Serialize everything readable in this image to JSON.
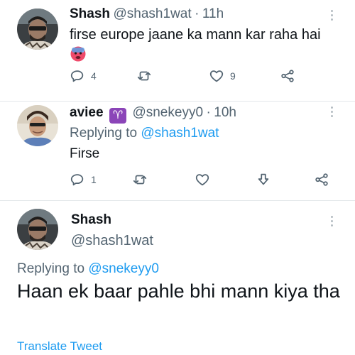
{
  "tweets": [
    {
      "name": "Shash",
      "handle": "@shash1wat",
      "dot": "·",
      "time": "11h",
      "text": "firse europe jaane ka mann kar raha hai",
      "emoji_icon": "sweating-face-emoji",
      "reply_count": "4",
      "like_count": "9"
    },
    {
      "name": "aviee",
      "badge_icon": "aries-emoji",
      "badge_glyph": "♈",
      "handle": "@snekeyy0",
      "dot": "·",
      "time": "10h",
      "replying_prefix": "Replying to",
      "replying_handle": "@shash1wat",
      "text": "Firse",
      "reply_count": "1"
    },
    {
      "name": "Shash",
      "handle": "@shash1wat",
      "replying_prefix": "Replying to",
      "replying_handle": "@snekeyy0",
      "text": "Haan ek baar pahle bhi mann kiya tha",
      "translate_label": "Translate Tweet"
    }
  ],
  "colors": {
    "link": "#1d9bf0",
    "muted": "#536471",
    "text": "#0f1419",
    "divider": "#e3e7ea",
    "aries_badge": "#8b45b8"
  }
}
